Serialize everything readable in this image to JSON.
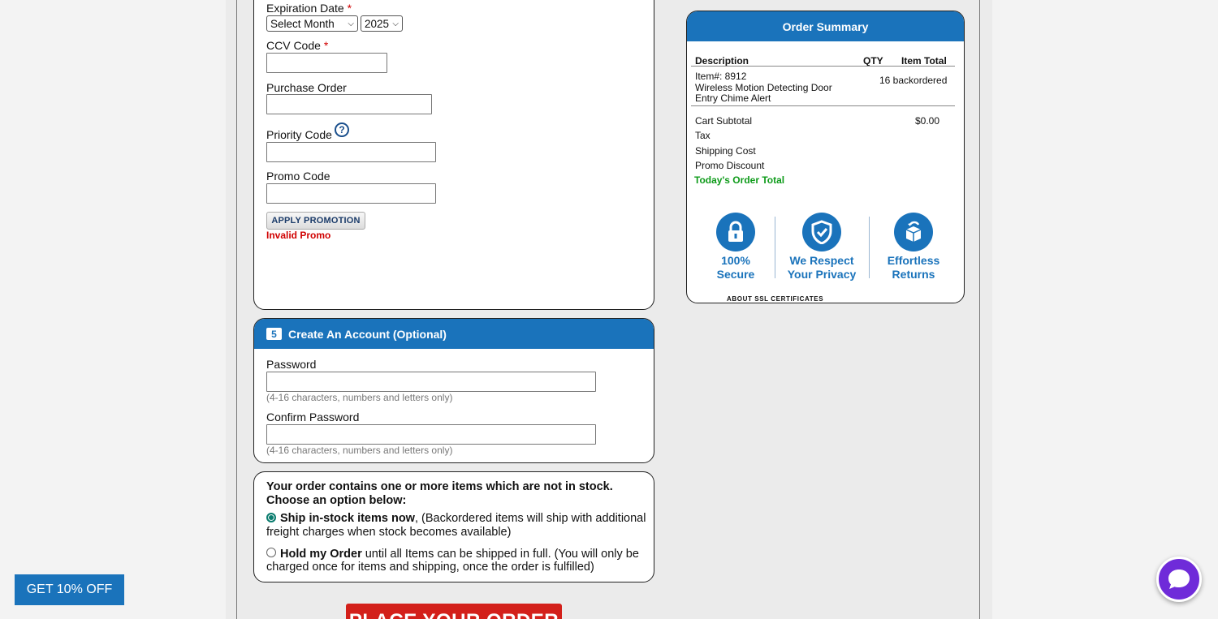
{
  "payment": {
    "expiration_label": "Expiration Date",
    "required_mark": "*",
    "month_select": "Select Month",
    "year_select": "2025",
    "ccv_label": "CCV Code",
    "po_label": "Purchase Order",
    "priority_label": "Priority Code",
    "help_glyph": "?",
    "promo_label": "Promo Code",
    "apply_button": "APPLY PROMOTION",
    "invalid_promo": "Invalid Promo"
  },
  "account": {
    "step": "5",
    "title": "Create An Account (Optional)",
    "password_label": "Password",
    "password_hint": "(4-16 characters, numbers and letters only)",
    "confirm_label": "Confirm Password",
    "confirm_hint": "(4-16 characters, numbers and letters only)"
  },
  "stock": {
    "title_line1": "Your order contains one or more items which are not in stock.",
    "title_line2": "Choose an option below:",
    "option1_bold": "Ship in-stock items now",
    "option1_rest_line1": ", (Backordered items will ship with additional",
    "option1_rest_line2": "freight charges when stock becomes available)",
    "option2_bold": "Hold my Order",
    "option2_rest_line1": " until all Items can be shipped in full. (You will only be",
    "option2_rest_line2": "charged once for items and shipping, once the order is fulfilled)",
    "selected": "ship-now"
  },
  "summary": {
    "title": "Order Summary",
    "col_description": "Description",
    "col_qty": "QTY",
    "col_total": "Item Total",
    "item_number": "Item#: 8912",
    "item_name_line1": "Wireless Motion Detecting Door",
    "item_name_line2": "Entry Chime Alert",
    "item_status": "16 backordered",
    "cart_subtotal_label": "Cart Subtotal",
    "cart_subtotal_value": "$0.00",
    "tax_label": "Tax",
    "shipping_label": "Shipping Cost",
    "promo_discount_label": "Promo Discount",
    "order_total_label": "Today's Order Total",
    "badges": [
      {
        "line1": "100%",
        "line2": "Secure",
        "icon": "lock-icon"
      },
      {
        "line1": "We Respect",
        "line2": "Your Privacy",
        "icon": "shield-check-icon"
      },
      {
        "line1": "Effortless",
        "line2": "Returns",
        "icon": "box-return-icon"
      }
    ],
    "ssl_link": "ABOUT SSL CERTIFICATES"
  },
  "place_order": "PLACE YOUR ORDER",
  "promo_popup": "GET 10% OFF",
  "colors": {
    "brand_blue": "#1a73bb",
    "error_red": "#d00000",
    "total_green": "#0e9b1a",
    "order_button": "#d3201a",
    "chat_purple": "#6f2bd9"
  }
}
